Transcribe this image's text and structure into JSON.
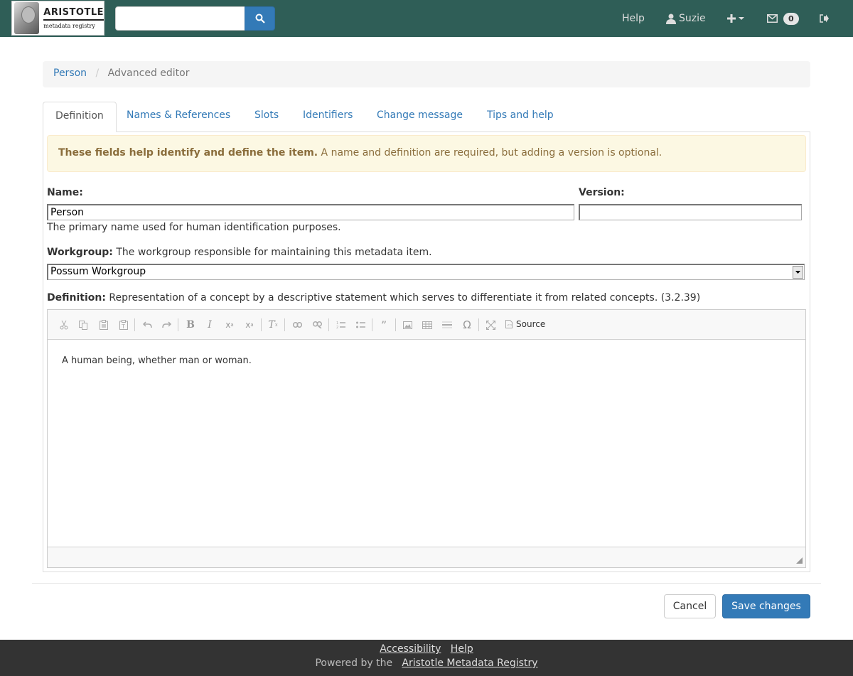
{
  "navbar": {
    "logo_title": "ARISTOTLE",
    "logo_subtitle": "metadata registry",
    "search_placeholder": "",
    "help_label": "Help",
    "user_label": "Suzie",
    "notification_count": "0"
  },
  "breadcrumb": {
    "parent": "Person",
    "current": "Advanced editor"
  },
  "tabs": [
    "Definition",
    "Names & References",
    "Slots",
    "Identifiers",
    "Change message",
    "Tips and help"
  ],
  "alert": {
    "bold": "These fields help identify and define the item.",
    "text": "A name and definition are required, but adding a version is optional."
  },
  "form": {
    "name_label": "Name:",
    "name_value": "Person",
    "name_help": "The primary name used for human identification purposes.",
    "version_label": "Version:",
    "version_value": "",
    "workgroup_label": "Workgroup:",
    "workgroup_help": "The workgroup responsible for maintaining this metadata item.",
    "workgroup_value": "Possum Workgroup",
    "definition_label": "Definition:",
    "definition_help": "Representation of a concept by a descriptive statement which serves to differentiate it from related concepts. (3.2.39)",
    "definition_value": "A human being, whether man or woman."
  },
  "editor": {
    "source_label": "Source"
  },
  "actions": {
    "cancel": "Cancel",
    "save": "Save changes"
  },
  "footer": {
    "accessibility": "Accessibility",
    "help": "Help",
    "powered_by": "Powered by the",
    "registry_link": "Aristotle Metadata Registry"
  }
}
